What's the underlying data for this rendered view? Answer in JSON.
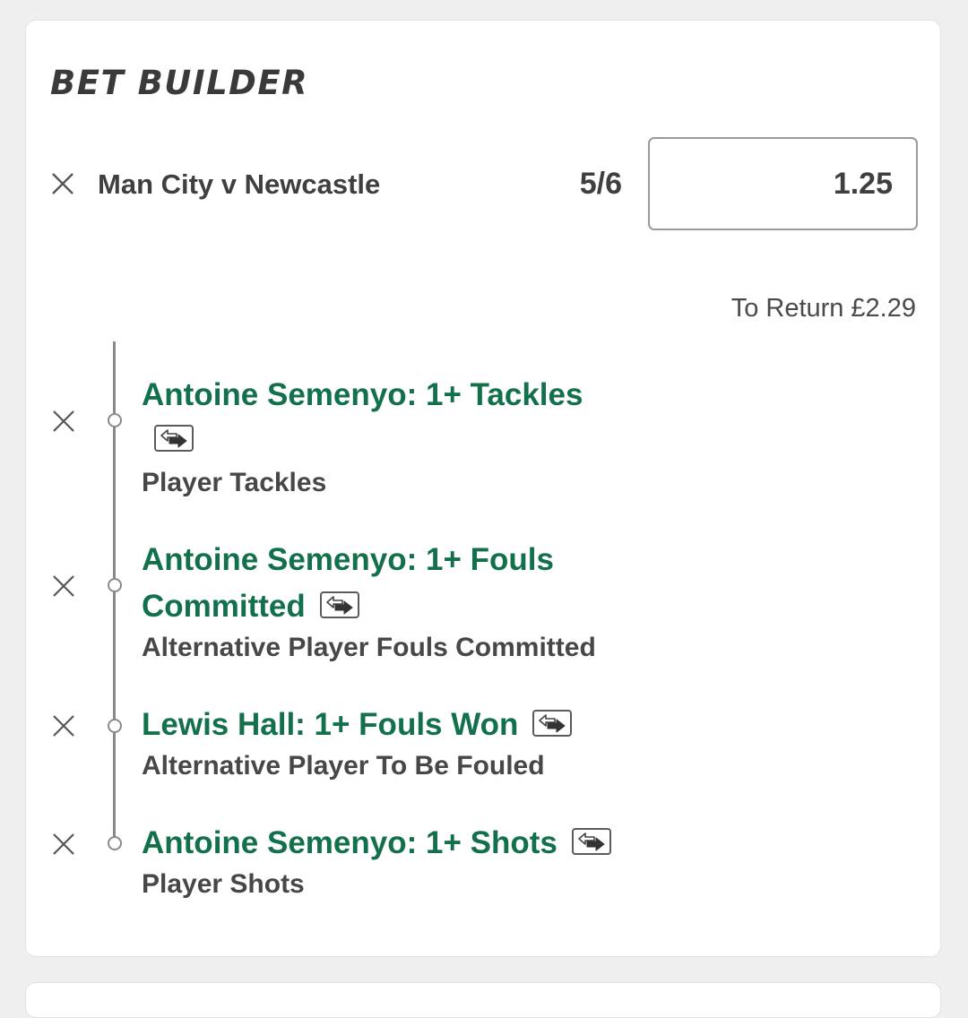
{
  "title": "BET BUILDER",
  "event": {
    "name": "Man City v Newcastle",
    "odds": "5/6",
    "stake": "1.25"
  },
  "return": {
    "label": "To Return",
    "value": "£2.29"
  },
  "selections": [
    {
      "title": "Antoine Semenyo: 1+ Tackles",
      "market": "Player Tackles"
    },
    {
      "title_line1": "Antoine Semenyo: 1+ Fouls",
      "title_line2": "Committed",
      "market": "Alternative Player Fouls Committed"
    },
    {
      "title": "Lewis Hall: 1+ Fouls Won",
      "market": "Alternative Player To Be Fouled"
    },
    {
      "title": "Antoine Semenyo: 1+ Shots",
      "market": "Player Shots"
    }
  ],
  "colors": {
    "selection_text": "#12714a",
    "body_text": "#3f3f3f",
    "background": "#efefef"
  },
  "icons": {
    "remove": "close-icon",
    "swap": "swap-icon"
  }
}
